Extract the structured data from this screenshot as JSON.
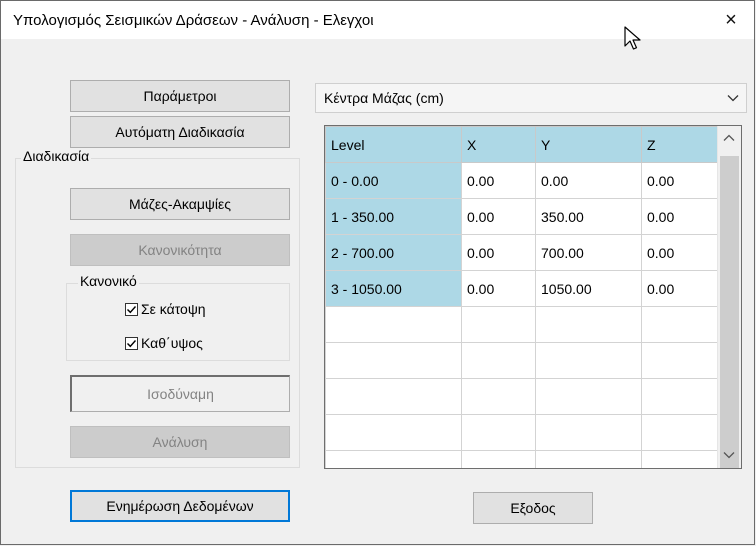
{
  "window": {
    "title": "Υπολογισμός Σεισμικών Δράσεων - Ανάλυση - Ελεγχοι",
    "close_label": "×"
  },
  "left": {
    "btn_parameters": "Παράμετροι",
    "btn_auto": "Αυτόματη Διαδικασία",
    "group_process": "Διαδικασία",
    "btn_masses": "Μάζες-Ακαμψίες",
    "btn_regularity": "Κανονικότητα",
    "group_regular": "Κανονικό",
    "check_plan": {
      "label": "Σε κάτοψη",
      "checked": true
    },
    "check_height": {
      "label": "Καθ΄υψος",
      "checked": true
    },
    "field_equivalent": "Ισοδύναμη",
    "btn_analysis": "Ανάλυση",
    "btn_update": "Ενημέρωση Δεδομένων"
  },
  "right": {
    "combo_value": "Κέντρα Μάζας (cm)",
    "columns": [
      "Level",
      "X",
      "Y",
      "Z"
    ],
    "rows": [
      [
        "0 - 0.00",
        "0.00",
        "0.00",
        "0.00"
      ],
      [
        "1 - 350.00",
        "0.00",
        "350.00",
        "0.00"
      ],
      [
        "2 - 700.00",
        "0.00",
        "700.00",
        "0.00"
      ],
      [
        "3 - 1050.00",
        "0.00",
        "1050.00",
        "0.00"
      ]
    ],
    "btn_exit": "Εξοδος"
  },
  "colors": {
    "header_bg": "#add8e6",
    "default_button_border": "#0078d7",
    "disabled_text": "#838383"
  }
}
